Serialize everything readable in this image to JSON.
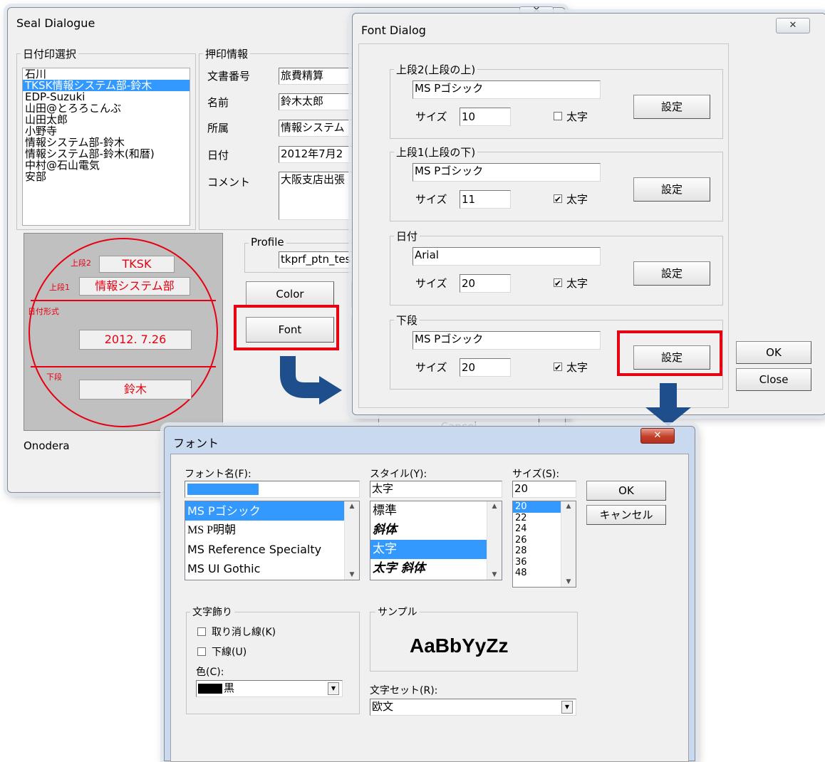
{
  "seal": {
    "title": "Seal Dialogue",
    "close_label": "✕",
    "date_group_label": "日付印選択",
    "date_list": [
      "石川",
      "TKSK情報システム部-鈴木",
      "EDP-Suzuki",
      "山田@とろろこんぶ",
      "山田太郎",
      "小野寺",
      "情報システム部-鈴木",
      "情報システム部-鈴木(和暦)",
      "中村@石山電気",
      "安部"
    ],
    "date_selected_index": 1,
    "info_group_label": "押印情報",
    "labels": [
      "文書番号",
      "名前",
      "所属",
      "日付",
      "コメント"
    ],
    "values": [
      "旅費精算",
      "鈴木太郎",
      "情報システム",
      "2012年7月2",
      "大阪支店出張"
    ],
    "stamp": {
      "label_top2": "上段2",
      "value_top2": "TKSK",
      "label_top1": "上段1",
      "value_top1": "情報システム部",
      "label_date": "日付形式",
      "value_date": "2012. 7.26",
      "label_bottom": "下段",
      "value_bottom": "鈴木"
    },
    "profile_label": "Profile",
    "profile_value": "tkprf_ptn_tes",
    "color_button": "Color",
    "font_button": "Font",
    "cancel_button": "Cancel",
    "footer_name": "Onodera"
  },
  "font_dialog": {
    "title": "Font Dialog",
    "close_label": "✕",
    "size_label": "サイズ",
    "bold_label": "太字",
    "set_button": "設定",
    "sections": [
      {
        "label": "上段2(上段の上)",
        "font": "MS Pゴシック",
        "size": "10",
        "bold": false
      },
      {
        "label": "上段1(上段の下)",
        "font": "MS Pゴシック",
        "size": "11",
        "bold": true
      },
      {
        "label": "日付",
        "font": "Arial",
        "size": "20",
        "bold": true
      },
      {
        "label": "下段",
        "font": "MS Pゴシック",
        "size": "20",
        "bold": true
      }
    ],
    "ok_button": "OK",
    "close_button": "Close"
  },
  "font_picker": {
    "title": "フォント",
    "close_label": "✕",
    "font_name_label": "フォント名(F):",
    "font_name_value": "MS Pゴシック",
    "font_list": [
      "MS Pゴシック",
      "MS P明朝",
      "MS Reference Specialty",
      "MS UI Gothic"
    ],
    "font_selected_index": 0,
    "style_label": "スタイル(Y):",
    "style_value": "太字",
    "style_list": [
      "標準",
      "斜体",
      "太字",
      "太字 斜体"
    ],
    "style_selected_index": 2,
    "size_label": "サイズ(S):",
    "size_value": "20",
    "size_list": [
      "20",
      "22",
      "24",
      "26",
      "28",
      "36",
      "48"
    ],
    "size_selected_index": 0,
    "ok_button": "OK",
    "cancel_button": "キャンセル",
    "effects_label": "文字飾り",
    "strike_label": "取り消し線(K)",
    "underline_label": "下線(U)",
    "color_label": "色(C):",
    "color_value": "黒",
    "color_swatch": "#000000",
    "sample_label": "サンプル",
    "sample_text": "AaBbYyZz",
    "charset_label": "文字セット(R):",
    "charset_value": "欧文"
  },
  "colors": {
    "accent_red": "#e60012",
    "arrow_blue": "#1f4e8c",
    "selection": "#3399ff"
  }
}
